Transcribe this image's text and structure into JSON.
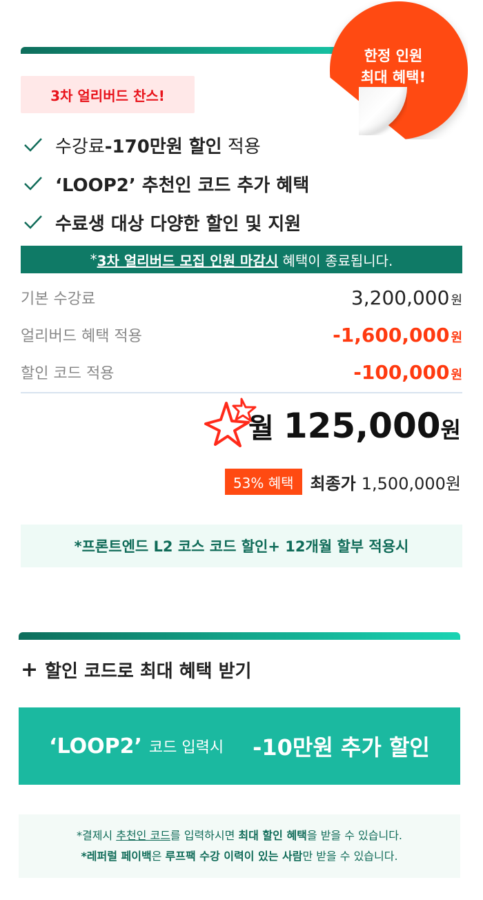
{
  "sticker": {
    "line1": "한정 인원",
    "line2": "최대 혜택!"
  },
  "badge": {
    "label": "3차 얼리버드 찬스!"
  },
  "checks": [
    {
      "pre": "수강료 ",
      "bold": "-170만원 할인",
      "post": " 적용"
    },
    {
      "pre": "",
      "bold": "‘LOOP2’ 추천인 코드 추가 혜택",
      "post": ""
    },
    {
      "pre": "",
      "bold": "수료생 대상 다양한 할인 및 지원",
      "post": ""
    }
  ],
  "notice": {
    "prefix": "*",
    "highlight": "3차 얼리버드 모집 인원 마감시",
    "suffix": " 혜택이 종료됩니다."
  },
  "prices": [
    {
      "label": "기본 수강료",
      "value": "3,200,000",
      "unit": "원"
    },
    {
      "label": "얼리버드 혜택 적용",
      "value": "-1,600,000",
      "unit": "원"
    },
    {
      "label": "할인 코드 적용",
      "value": "-100,000",
      "unit": "원"
    }
  ],
  "monthly": {
    "prefix": "월",
    "amount": "125,000",
    "unit": "원"
  },
  "final": {
    "percent_badge": "53% 혜택",
    "label": "최종가",
    "amount": "1,500,000원"
  },
  "note": {
    "text": "*프론트엔드 L2 코스 코드 할인+ 12개월 할부 적용시"
  },
  "section2": {
    "plus": "+",
    "title": "할인 코드로 최대 혜택 받기"
  },
  "code_banner": {
    "code": "‘LOOP2’",
    "sub": "코드 입력시",
    "discount": "-10만원 추가 할인"
  },
  "info": {
    "l1_a": "*결제시 ",
    "l1_b": "추천인 코드",
    "l1_c": "를 입력하시면 ",
    "l1_d": "최대 할인 혜택",
    "l1_e": "을 받을 수 있습니다.",
    "l2_a": "*레퍼럴 페이백",
    "l2_b": "은 ",
    "l2_c": "루프팩 수강 이력이 있는 사람",
    "l2_d": "만 받을 수 있습니다."
  },
  "colors": {
    "accent_green": "#1bb9a0",
    "dark_green": "#0f7a66",
    "accent_orange": "#ff4a12",
    "red": "#ff3a10"
  }
}
